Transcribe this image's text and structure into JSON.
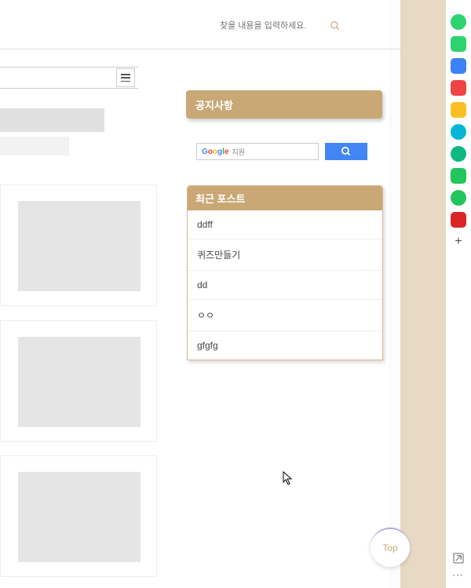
{
  "search": {
    "placeholder": "찾을 내용을 입력하세요."
  },
  "notice": {
    "title": "공지사항"
  },
  "google": {
    "label": "지원"
  },
  "recent": {
    "title": "최근 포스트",
    "items": [
      "ddff",
      "퀴즈만들기",
      "dd",
      "ㅇㅇ",
      "gfgfg"
    ]
  },
  "top_button": "Top",
  "sidebar_colors": [
    "#2dd36f",
    "#2dd36f",
    "#3b82f6",
    "#ef4444",
    "#fbbf24",
    "#06b6d4",
    "#10b981",
    "#22c55e",
    "#22c55e",
    "#dc2626"
  ]
}
